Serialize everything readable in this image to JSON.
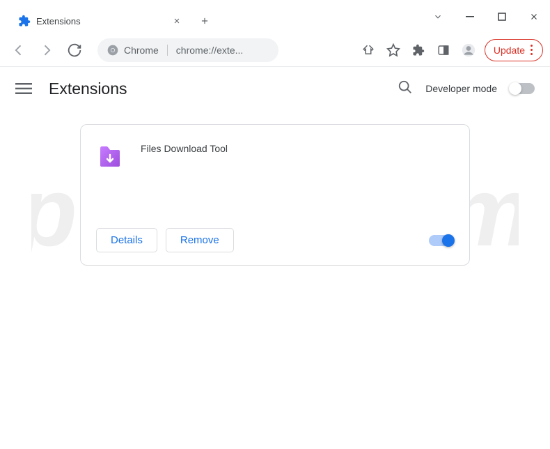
{
  "tab": {
    "title": "Extensions"
  },
  "omnibox": {
    "label": "Chrome",
    "url": "chrome://exte..."
  },
  "toolbar": {
    "update_label": "Update"
  },
  "ext_header": {
    "title": "Extensions",
    "dev_mode_label": "Developer mode"
  },
  "extension": {
    "name": "Files Download Tool",
    "details_label": "Details",
    "remove_label": "Remove",
    "enabled": true
  }
}
